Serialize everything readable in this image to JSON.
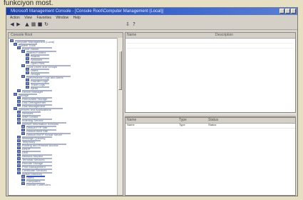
{
  "caption": "funkciyon most.",
  "window": {
    "title": "Microsoft Management Console - [Console Root\\Computer Management (Local)]",
    "menu": [
      "Action",
      "View",
      "Favorites",
      "Window",
      "Help"
    ],
    "toolbar_icons": [
      "back-icon",
      "forward-icon",
      "up-icon",
      "show-hide-tree-icon",
      "properties-icon",
      "refresh-icon",
      "export-icon",
      "help-icon"
    ]
  },
  "tree": {
    "header": "Console Root",
    "items": [
      "Computer Management (Local)",
      "System Tools",
      "Event Viewer",
      "Shared Folders",
      "Shares",
      "Sessions",
      "Open Files",
      "Local Users and Groups",
      "Users",
      "Groups",
      "Performance Logs and Alerts",
      "Counter Logs",
      "Trace Logs",
      "Alerts",
      "Device Manager",
      "Storage",
      "Removable Storage",
      "Disk Defragmenter",
      "Disk Management",
      "Services and Applications",
      "Services",
      "WMI Control",
      "Indexing Service",
      "Internet Information Services",
      "Default FTP Site",
      "Default Web Site",
      "Default SMTP Virtual Server",
      "Message Queuing",
      "Telephony",
      "Routing and Remote Access",
      "DHCP",
      "DNS",
      "Network Monitor",
      "Terminal Services",
      "Remote Storage",
      "Print Management",
      "Certificate Services",
      "Active Directory",
      "Users",
      "Computers",
      "Domain Controllers"
    ]
  },
  "right": {
    "top_headers": [
      "Name",
      "Description"
    ],
    "bottom_headers": [
      "Name",
      "Type",
      "Status"
    ],
    "bottom_row": [
      "Name",
      "Type",
      "Status"
    ]
  }
}
